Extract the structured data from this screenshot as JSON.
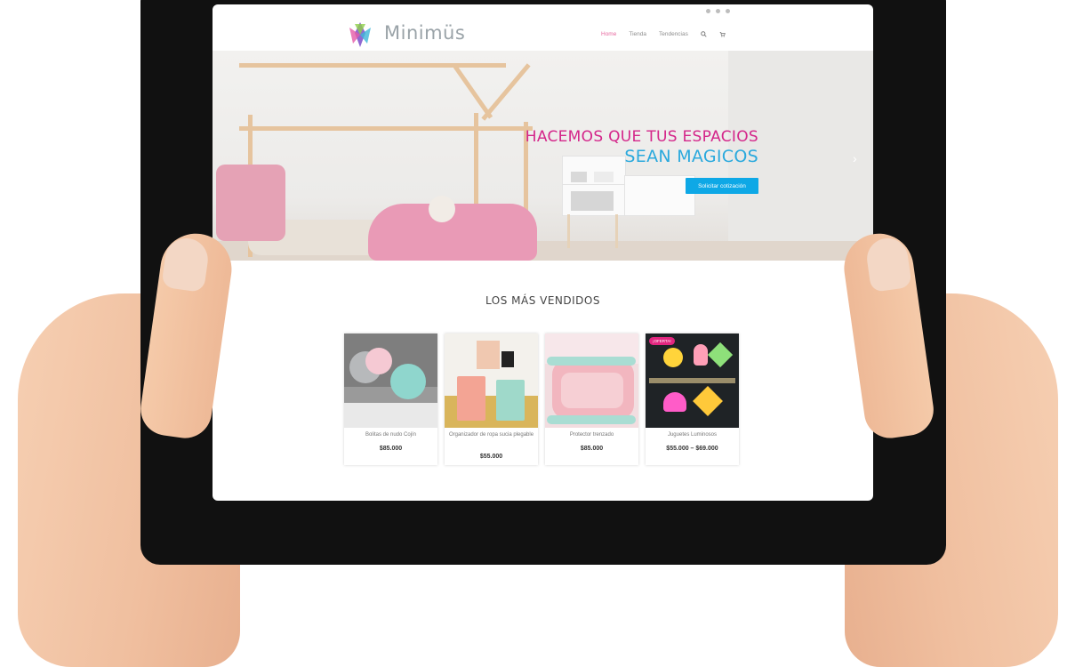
{
  "topbar": {
    "contact": "",
    "social_icons": [
      "facebook-icon",
      "instagram-icon",
      "whatsapp-icon"
    ]
  },
  "header": {
    "logo_text": "Minimüs",
    "logo_tagline": "",
    "nav": [
      {
        "label": "Home",
        "active": true
      },
      {
        "label": "Tienda",
        "active": false
      },
      {
        "label": "Tendencias",
        "active": false
      }
    ],
    "icons": [
      "search-icon",
      "cart-icon"
    ]
  },
  "hero": {
    "title_line1": "HACEMOS QUE TUS ESPACIOS",
    "title_line2": "SEAN MAGICOS",
    "cta_label": "Solicitar cotización",
    "next_arrow": "›"
  },
  "bestsellers": {
    "title": "LOS MÁS VENDIDOS",
    "products": [
      {
        "name": "Bolitas de nudo Cojín",
        "price": "$85.000",
        "badge": ""
      },
      {
        "name": "Organizador de ropa sucia plegable",
        "price": "$55.000",
        "badge": ""
      },
      {
        "name": "Protector trenzado",
        "price": "$85.000",
        "badge": ""
      },
      {
        "name": "Juguetes Luminosos",
        "price": "$55.000 – $69.000",
        "badge": "¡OFERTA!"
      }
    ]
  },
  "colors": {
    "accent_pink": "#d4268a",
    "accent_blue": "#2aa9dd",
    "button_blue": "#0ea8e6",
    "nav_active": "#e76aa0"
  }
}
